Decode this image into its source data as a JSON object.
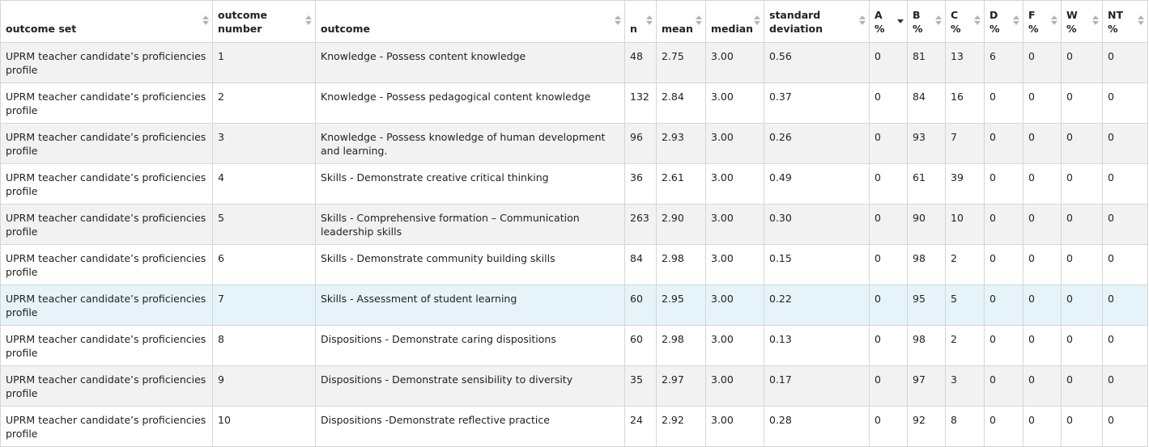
{
  "table": {
    "columns": [
      {
        "key": "outcome_set",
        "label": "outcome set",
        "sort": "none"
      },
      {
        "key": "outcome_number",
        "label": "outcome number",
        "sort": "none"
      },
      {
        "key": "outcome",
        "label": "outcome",
        "sort": "none"
      },
      {
        "key": "n",
        "label": "n",
        "sort": "none"
      },
      {
        "key": "mean",
        "label": "mean",
        "sort": "none"
      },
      {
        "key": "median",
        "label": "median",
        "sort": "none"
      },
      {
        "key": "std",
        "label": "standard deviation",
        "sort": "none"
      },
      {
        "key": "a",
        "label": "A %",
        "sort": "descending"
      },
      {
        "key": "b",
        "label": "B %",
        "sort": "none"
      },
      {
        "key": "c",
        "label": "C %",
        "sort": "none"
      },
      {
        "key": "d",
        "label": "D %",
        "sort": "none"
      },
      {
        "key": "f",
        "label": "F %",
        "sort": "none"
      },
      {
        "key": "w",
        "label": "W %",
        "sort": "none"
      },
      {
        "key": "nt",
        "label": "NT %",
        "sort": "none"
      }
    ],
    "highlighted_row": 6,
    "rows": [
      [
        "UPRM teacher candidate’s proficiencies profile",
        "1",
        "Knowledge - Possess content knowledge",
        "48",
        "2.75",
        "3.00",
        "0.56",
        "0",
        "81",
        "13",
        "6",
        "0",
        "0",
        "0"
      ],
      [
        "UPRM teacher candidate’s proficiencies profile",
        "2",
        "Knowledge - Possess pedagogical content knowledge",
        "132",
        "2.84",
        "3.00",
        "0.37",
        "0",
        "84",
        "16",
        "0",
        "0",
        "0",
        "0"
      ],
      [
        "UPRM teacher candidate’s proficiencies profile",
        "3",
        "Knowledge - Possess knowledge of human development and learning.",
        "96",
        "2.93",
        "3.00",
        "0.26",
        "0",
        "93",
        "7",
        "0",
        "0",
        "0",
        "0"
      ],
      [
        "UPRM teacher candidate’s proficiencies profile",
        "4",
        "Skills - Demonstrate creative critical thinking",
        "36",
        "2.61",
        "3.00",
        "0.49",
        "0",
        "61",
        "39",
        "0",
        "0",
        "0",
        "0"
      ],
      [
        "UPRM teacher candidate’s proficiencies profile",
        "5",
        "Skills - Comprehensive formation – Communication leadership skills",
        "263",
        "2.90",
        "3.00",
        "0.30",
        "0",
        "90",
        "10",
        "0",
        "0",
        "0",
        "0"
      ],
      [
        "UPRM teacher candidate’s proficiencies profile",
        "6",
        "Skills - Demonstrate community building skills",
        "84",
        "2.98",
        "3.00",
        "0.15",
        "0",
        "98",
        "2",
        "0",
        "0",
        "0",
        "0"
      ],
      [
        "UPRM teacher candidate’s proficiencies profile",
        "7",
        "Skills - Assessment of student learning",
        "60",
        "2.95",
        "3.00",
        "0.22",
        "0",
        "95",
        "5",
        "0",
        "0",
        "0",
        "0"
      ],
      [
        "UPRM teacher candidate’s proficiencies profile",
        "8",
        "Dispositions - Demonstrate caring dispositions",
        "60",
        "2.98",
        "3.00",
        "0.13",
        "0",
        "98",
        "2",
        "0",
        "0",
        "0",
        "0"
      ],
      [
        "UPRM teacher candidate’s proficiencies profile",
        "9",
        "Dispositions - Demonstrate sensibility to diversity",
        "35",
        "2.97",
        "3.00",
        "0.17",
        "0",
        "97",
        "3",
        "0",
        "0",
        "0",
        "0"
      ],
      [
        "UPRM teacher candidate’s proficiencies profile",
        "10",
        "Dispositions -Demonstrate reflective practice",
        "24",
        "2.92",
        "3.00",
        "0.28",
        "0",
        "92",
        "8",
        "0",
        "0",
        "0",
        "0"
      ]
    ]
  }
}
